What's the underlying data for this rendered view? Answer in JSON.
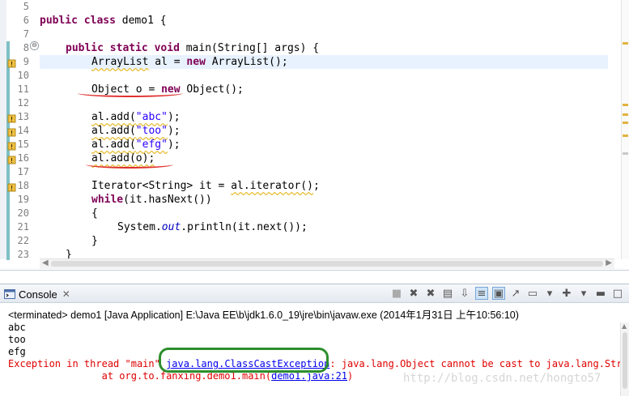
{
  "editor": {
    "line_numbers": [
      "5",
      "6",
      "7",
      "8",
      "9",
      "10",
      "11",
      "12",
      "13",
      "14",
      "15",
      "16",
      "17",
      "18",
      "19",
      "20",
      "21",
      "22",
      "23"
    ],
    "fold_symbol": "⊖",
    "lines": {
      "l6_kw1": "public",
      "l6_kw2": "class",
      "l6_rest": " demo1 {",
      "l8_kw1": "public",
      "l8_kw2": "static",
      "l8_kw3": "void",
      "l8_rest": " main(String[] args) {",
      "l9_a": "ArrayList",
      "l9_b": " al = ",
      "l9_kw": "new",
      "l9_c": " ArrayList();",
      "l11_a": "Object o = ",
      "l11_kw": "new",
      "l11_b": " Object();",
      "l13_a": "al.add(",
      "l13_s": "\"abc\"",
      "l13_b": ");",
      "l14_a": "al.add(",
      "l14_s": "\"too\"",
      "l14_b": ");",
      "l15_a": "al.add(",
      "l15_s": "\"efg\"",
      "l15_b": ");",
      "l16": "al.add(o);",
      "l18_a": "Iterator<String> it = ",
      "l18_b": "al.iterator()",
      "l18_c": ";",
      "l19_kw": "while",
      "l19_rest": "(it.hasNext())",
      "l20": "{",
      "l21_a": "System.",
      "l21_out": "out",
      "l21_b": ".println(it.next());",
      "l22": "}",
      "l23": "}"
    }
  },
  "console": {
    "tab_label": "Console",
    "tab_close": "✕",
    "status": "<terminated> demo1 [Java Application] E:\\Java EE\\b\\jdk1.6.0_19\\jre\\bin\\javaw.exe (2014年1月31日 上午10:56:10)",
    "output_lines": [
      "abc",
      "too",
      "efg"
    ],
    "exception_prefix": "Exception in thread \"main\" ",
    "exception_class": "java.lang.ClassCastException",
    "exception_message": ": java.lang.Object cannot be cast to java.lang.String",
    "trace_prefix": "\tat org.to.fanxing.demo1.main(",
    "trace_link": "demo1.java:21",
    "trace_suffix": ")",
    "toolbar_icons": [
      "terminate-icon",
      "remove-launch-icon",
      "remove-all-icon",
      "clear-console-icon",
      "scroll-lock-icon",
      "word-wrap-icon",
      "show-on-output-icon",
      "pin-console-icon",
      "display-console-icon",
      "new-console-icon",
      "minimize-icon",
      "maximize-icon"
    ]
  },
  "watermark": "http://blog.csdn.net/hongto57",
  "colors": {
    "keyword": "#7f0055",
    "string": "#2a00ff",
    "error": "#e00000",
    "annotation_red": "#e03030",
    "annotation_green": "#2d8e2d"
  }
}
